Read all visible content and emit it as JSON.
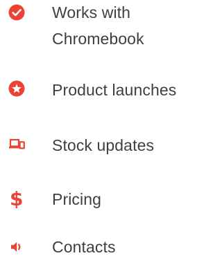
{
  "features": {
    "items": [
      {
        "icon": "check-circle-icon",
        "lines": [
          "Works with",
          "Chromebook"
        ]
      },
      {
        "icon": "star-circle-icon",
        "label": "Product launches"
      },
      {
        "icon": "devices-icon",
        "label": "Stock updates"
      },
      {
        "icon": "dollar-icon",
        "glyph": "$",
        "label": "Pricing"
      },
      {
        "icon": "speaker-icon",
        "label": "Contacts"
      }
    ]
  },
  "colors": {
    "accent": "#ea4335",
    "text": "#3c4043",
    "background": "#ffffff"
  }
}
